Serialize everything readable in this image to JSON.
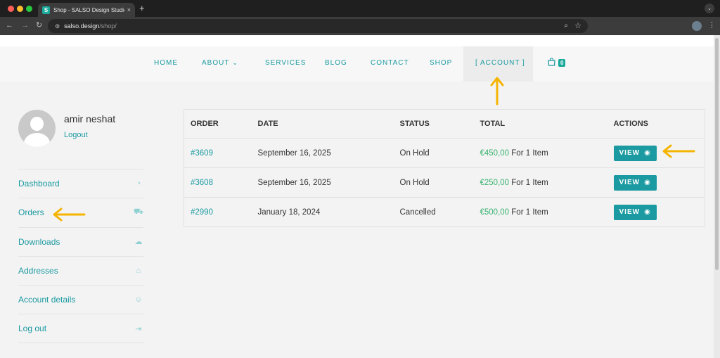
{
  "browser": {
    "tab_title": "Shop - SALSO Design Studio",
    "tab_close": "×",
    "new_tab": "+",
    "url_host": "salso.design",
    "url_path": "/shop/"
  },
  "site_nav": {
    "items": [
      "HOME",
      "ABOUT",
      "SERVICES",
      "BLOG",
      "CONTACT",
      "SHOP",
      "[ ACCOUNT ]"
    ],
    "cart_count": "0"
  },
  "user": {
    "name": "amir neshat",
    "logout": "Logout"
  },
  "side_menu": {
    "items": [
      "Dashboard",
      "Orders",
      "Downloads",
      "Addresses",
      "Account details",
      "Log out"
    ]
  },
  "orders": {
    "headers": [
      "ORDER",
      "DATE",
      "STATUS",
      "TOTAL",
      "ACTIONS"
    ],
    "rows": [
      {
        "order": "#3609",
        "date": "September 16, 2025",
        "status": "On Hold",
        "amount": "€450,00",
        "items": "For 1 Item",
        "action": "VIEW"
      },
      {
        "order": "#3608",
        "date": "September 16, 2025",
        "status": "On Hold",
        "amount": "€250,00",
        "items": "For 1 Item",
        "action": "VIEW"
      },
      {
        "order": "#2990",
        "date": "January 18, 2024",
        "status": "Cancelled",
        "amount": "€500,00",
        "items": "For 1 Item",
        "action": "VIEW"
      }
    ]
  },
  "colors": {
    "accent": "#1b9aa1",
    "price": "#3cb371",
    "annotation_arrow": "#f5b400"
  }
}
